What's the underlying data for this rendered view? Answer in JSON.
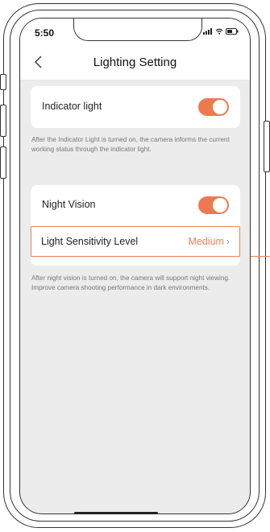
{
  "status_bar": {
    "time": "5:50"
  },
  "nav": {
    "title": "Lighting Setting",
    "back_icon": "chevron-left-icon"
  },
  "indicator": {
    "label": "Indicator light",
    "enabled": true,
    "description": "After the Indicator Light is turned on, the camera informs the current working status through the indicator light."
  },
  "night_vision": {
    "label": "Night Vision",
    "enabled": true,
    "sensitivity_label": "Light Sensitivity Level",
    "sensitivity_value": "Medium",
    "chevron": "›",
    "description": "After night vision is turned on, the camera will support night viewing. Improve camera shooting performance in dark environments."
  },
  "colors": {
    "accent": "#ee7a52",
    "highlight_border": "#e9835c",
    "background": "#ececec"
  }
}
